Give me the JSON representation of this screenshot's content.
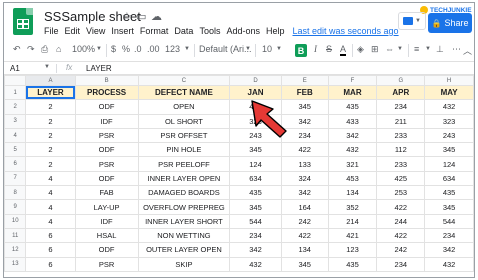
{
  "app": {
    "title": "SSSample sheet",
    "last_edit": "Last edit was seconds ago",
    "share_label": "Share",
    "watermark": "TECHJUNKIE"
  },
  "menu": [
    "File",
    "Edit",
    "View",
    "Insert",
    "Format",
    "Data",
    "Tools",
    "Add-ons",
    "Help"
  ],
  "toolbar": {
    "zoom": "100%",
    "currency": "$",
    "percent": "%",
    "decimal_less": ".0",
    "decimal_more": ".00",
    "number_format": "123",
    "font": "Default (Ari...",
    "font_size": "10",
    "bold": "B",
    "italic": "I",
    "strike": "S",
    "text_color": "A"
  },
  "formula_bar": {
    "cell_ref": "A1",
    "fx": "fx",
    "value": "LAYER"
  },
  "columns": [
    "A",
    "B",
    "C",
    "D",
    "E",
    "F",
    "G",
    "H"
  ],
  "rows": [
    [
      "LAYER",
      "PROCESS",
      "DEFECT NAME",
      "JAN",
      "FEB",
      "MAR",
      "APR",
      "MAY"
    ],
    [
      "2",
      "ODF",
      "OPEN",
      "432",
      "345",
      "435",
      "234",
      "432"
    ],
    [
      "2",
      "IDF",
      "OL SHORT",
      "323",
      "342",
      "433",
      "211",
      "323"
    ],
    [
      "2",
      "PSR",
      "PSR OFFSET",
      "243",
      "234",
      "342",
      "233",
      "243"
    ],
    [
      "2",
      "ODF",
      "PIN HOLE",
      "345",
      "422",
      "432",
      "112",
      "345"
    ],
    [
      "2",
      "PSR",
      "PSR PEELOFF",
      "124",
      "133",
      "321",
      "233",
      "124"
    ],
    [
      "4",
      "ODF",
      "INNER LAYER OPEN",
      "634",
      "324",
      "453",
      "425",
      "634"
    ],
    [
      "4",
      "FAB",
      "DAMAGED BOARDS",
      "435",
      "342",
      "134",
      "253",
      "435"
    ],
    [
      "4",
      "LAY-UP",
      "OVERFLOW PREPREG",
      "345",
      "164",
      "352",
      "422",
      "345"
    ],
    [
      "4",
      "IDF",
      "INNER LAYER SHORT",
      "544",
      "242",
      "214",
      "244",
      "544"
    ],
    [
      "6",
      "HSAL",
      "NON WETTING",
      "234",
      "422",
      "421",
      "422",
      "234"
    ],
    [
      "6",
      "ODF",
      "OUTER LAYER OPEN",
      "342",
      "134",
      "123",
      "242",
      "342"
    ],
    [
      "6",
      "PSR",
      "SKIP",
      "432",
      "345",
      "435",
      "234",
      "432"
    ]
  ],
  "colors": {
    "header_fill": "#fff2cc",
    "accent": "#1a73e8",
    "brand": "#0f9d58",
    "arrow": "#e53935"
  }
}
